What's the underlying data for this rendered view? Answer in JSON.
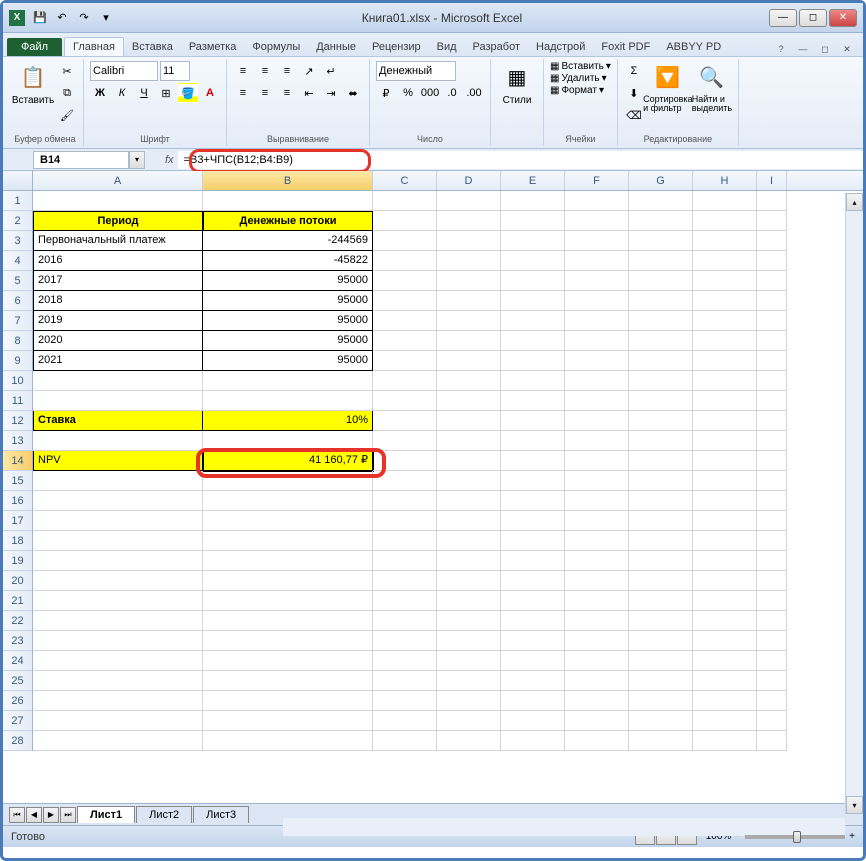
{
  "window": {
    "title": "Книга01.xlsx - Microsoft Excel"
  },
  "ribbon": {
    "file": "Файл",
    "tabs": [
      "Главная",
      "Вставка",
      "Разметка",
      "Формулы",
      "Данные",
      "Рецензир",
      "Вид",
      "Разработ",
      "Надстрой",
      "Foxit PDF",
      "ABBYY PD"
    ],
    "groups": {
      "clipboard": "Буфер обмена",
      "paste": "Вставить",
      "font": "Шрифт",
      "font_name": "Calibri",
      "font_size": "11",
      "alignment": "Выравнивание",
      "number": "Число",
      "number_format": "Денежный",
      "styles": "Стили",
      "cells": "Ячейки",
      "insert": "Вставить",
      "delete": "Удалить",
      "format": "Формат",
      "editing": "Редактирование",
      "sort": "Сортировка и фильтр",
      "find": "Найти и выделить"
    }
  },
  "namebox": "B14",
  "formula": "=B3+ЧПС(B12;B4:B9)",
  "columns": [
    "A",
    "B",
    "C",
    "D",
    "E",
    "F",
    "G",
    "H",
    "I"
  ],
  "table": {
    "h1": "Период",
    "h2": "Денежные потоки",
    "rows": [
      {
        "a": "Первоначальный платеж",
        "b": "-244569"
      },
      {
        "a": "2016",
        "b": "-45822"
      },
      {
        "a": "2017",
        "b": "95000"
      },
      {
        "a": "2018",
        "b": "95000"
      },
      {
        "a": "2019",
        "b": "95000"
      },
      {
        "a": "2020",
        "b": "95000"
      },
      {
        "a": "2021",
        "b": "95000"
      }
    ],
    "rate_label": "Ставка",
    "rate_value": "10%",
    "npv_label": "NPV",
    "npv_value": "41 160,77 ₽"
  },
  "sheets": [
    "Лист1",
    "Лист2",
    "Лист3"
  ],
  "status": "Готово",
  "zoom": "100%"
}
